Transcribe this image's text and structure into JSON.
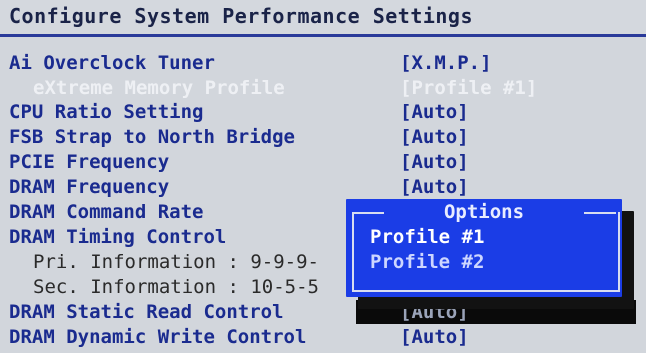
{
  "page": {
    "title": "Configure System Performance Settings"
  },
  "settings": [
    {
      "label": "Ai Overclock Tuner",
      "value": "[X.M.P.]"
    },
    {
      "label": "eXtreme Memory Profile",
      "value": "[Profile #1]"
    },
    {
      "label": "CPU Ratio Setting",
      "value": "[Auto]"
    },
    {
      "label": "FSB Strap to North Bridge",
      "value": "[Auto]"
    },
    {
      "label": "PCIE Frequency",
      "value": "[Auto]"
    },
    {
      "label": "DRAM Frequency",
      "value": "[Auto]"
    },
    {
      "label": "DRAM Command Rate",
      "value": ""
    },
    {
      "label": "DRAM Timing Control",
      "value": ""
    },
    {
      "label": "Pri. Information : 9-9-9-",
      "value": ""
    },
    {
      "label": "Sec. Information : 10-5-5",
      "value": ""
    },
    {
      "label": "DRAM Static Read Control",
      "value": "[Auto]"
    },
    {
      "label": "DRAM Dynamic Write Control",
      "value": "[Auto]"
    }
  ],
  "popup": {
    "title": "Options",
    "options": [
      "Profile #1",
      "Profile #2"
    ],
    "selected": "Profile #1"
  },
  "colors": {
    "background": "#d2d6dc",
    "label_blue": "#1a2b8f",
    "popup_blue": "#1b3de6",
    "highlight_black": "#0a0a0a"
  }
}
